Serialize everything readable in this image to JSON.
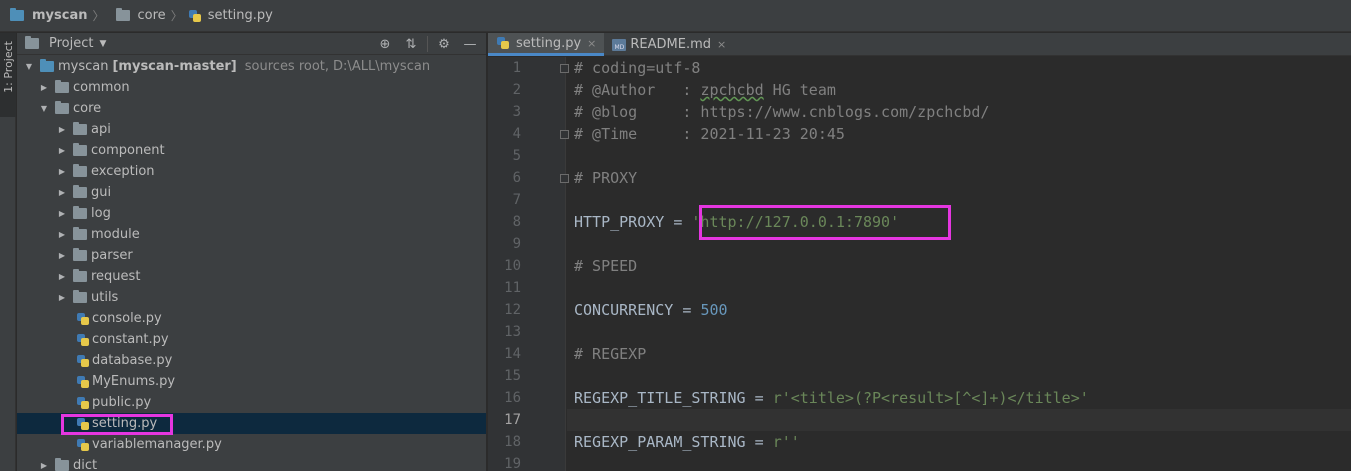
{
  "breadcrumb": {
    "items": [
      {
        "label": "myscan",
        "icon": "folder-icon"
      },
      {
        "label": "core",
        "icon": "folder-icon"
      },
      {
        "label": "setting.py",
        "icon": "python-file-icon"
      }
    ]
  },
  "tool_strip": {
    "project_tab": "1: Project"
  },
  "project_panel": {
    "title": "Project",
    "tree": {
      "root": {
        "name": "myscan",
        "module": "[myscan-master]",
        "note": "sources root,",
        "path": "D:\\ALL\\myscan"
      },
      "common": "common",
      "core": "core",
      "core_children_dirs": [
        "api",
        "component",
        "exception",
        "gui",
        "log",
        "module",
        "parser",
        "request",
        "utils"
      ],
      "core_children_files": [
        "console.py",
        "constant.py",
        "database.py",
        "MyEnums.py",
        "public.py",
        "setting.py",
        "variablemanager.py"
      ],
      "dict": "dict"
    }
  },
  "editor": {
    "tabs": [
      {
        "label": "setting.py",
        "close": "×"
      },
      {
        "label": "README.md",
        "close": "×"
      }
    ],
    "md_icon_text": "MD",
    "line_numbers": [
      "1",
      "2",
      "3",
      "4",
      "5",
      "6",
      "7",
      "8",
      "9",
      "10",
      "11",
      "12",
      "13",
      "14",
      "15",
      "16",
      "17",
      "18",
      "19"
    ],
    "lines": {
      "l1": "# coding=utf-8",
      "l2a": "# @Author   : ",
      "l2b": "zpchcbd",
      "l2c": " HG team",
      "l3": "# @blog     : https://www.cnblogs.com/zpchcbd/",
      "l4": "# @Time     : 2021-11-23 20:45",
      "l6": "# PROXY",
      "l8a": "HTTP_PROXY = ",
      "l8b": "'http://127.0.0.1:7890'",
      "l10": "# SPEED",
      "l12a": "CONCURRENCY = ",
      "l12b": "500",
      "l14": "# REGEXP",
      "l16a": "REGEXP_TITLE_STRING = ",
      "l16b": "r'<title>(?P<result>[^<]+)</title>'",
      "l18a": "REGEXP_PARAM_STRING = ",
      "l18b": "r''"
    }
  },
  "colors": {
    "highlight": "#e536e0",
    "selection": "#0d293e",
    "string": "#6a8759",
    "number": "#6897bb",
    "comment": "#808080"
  }
}
